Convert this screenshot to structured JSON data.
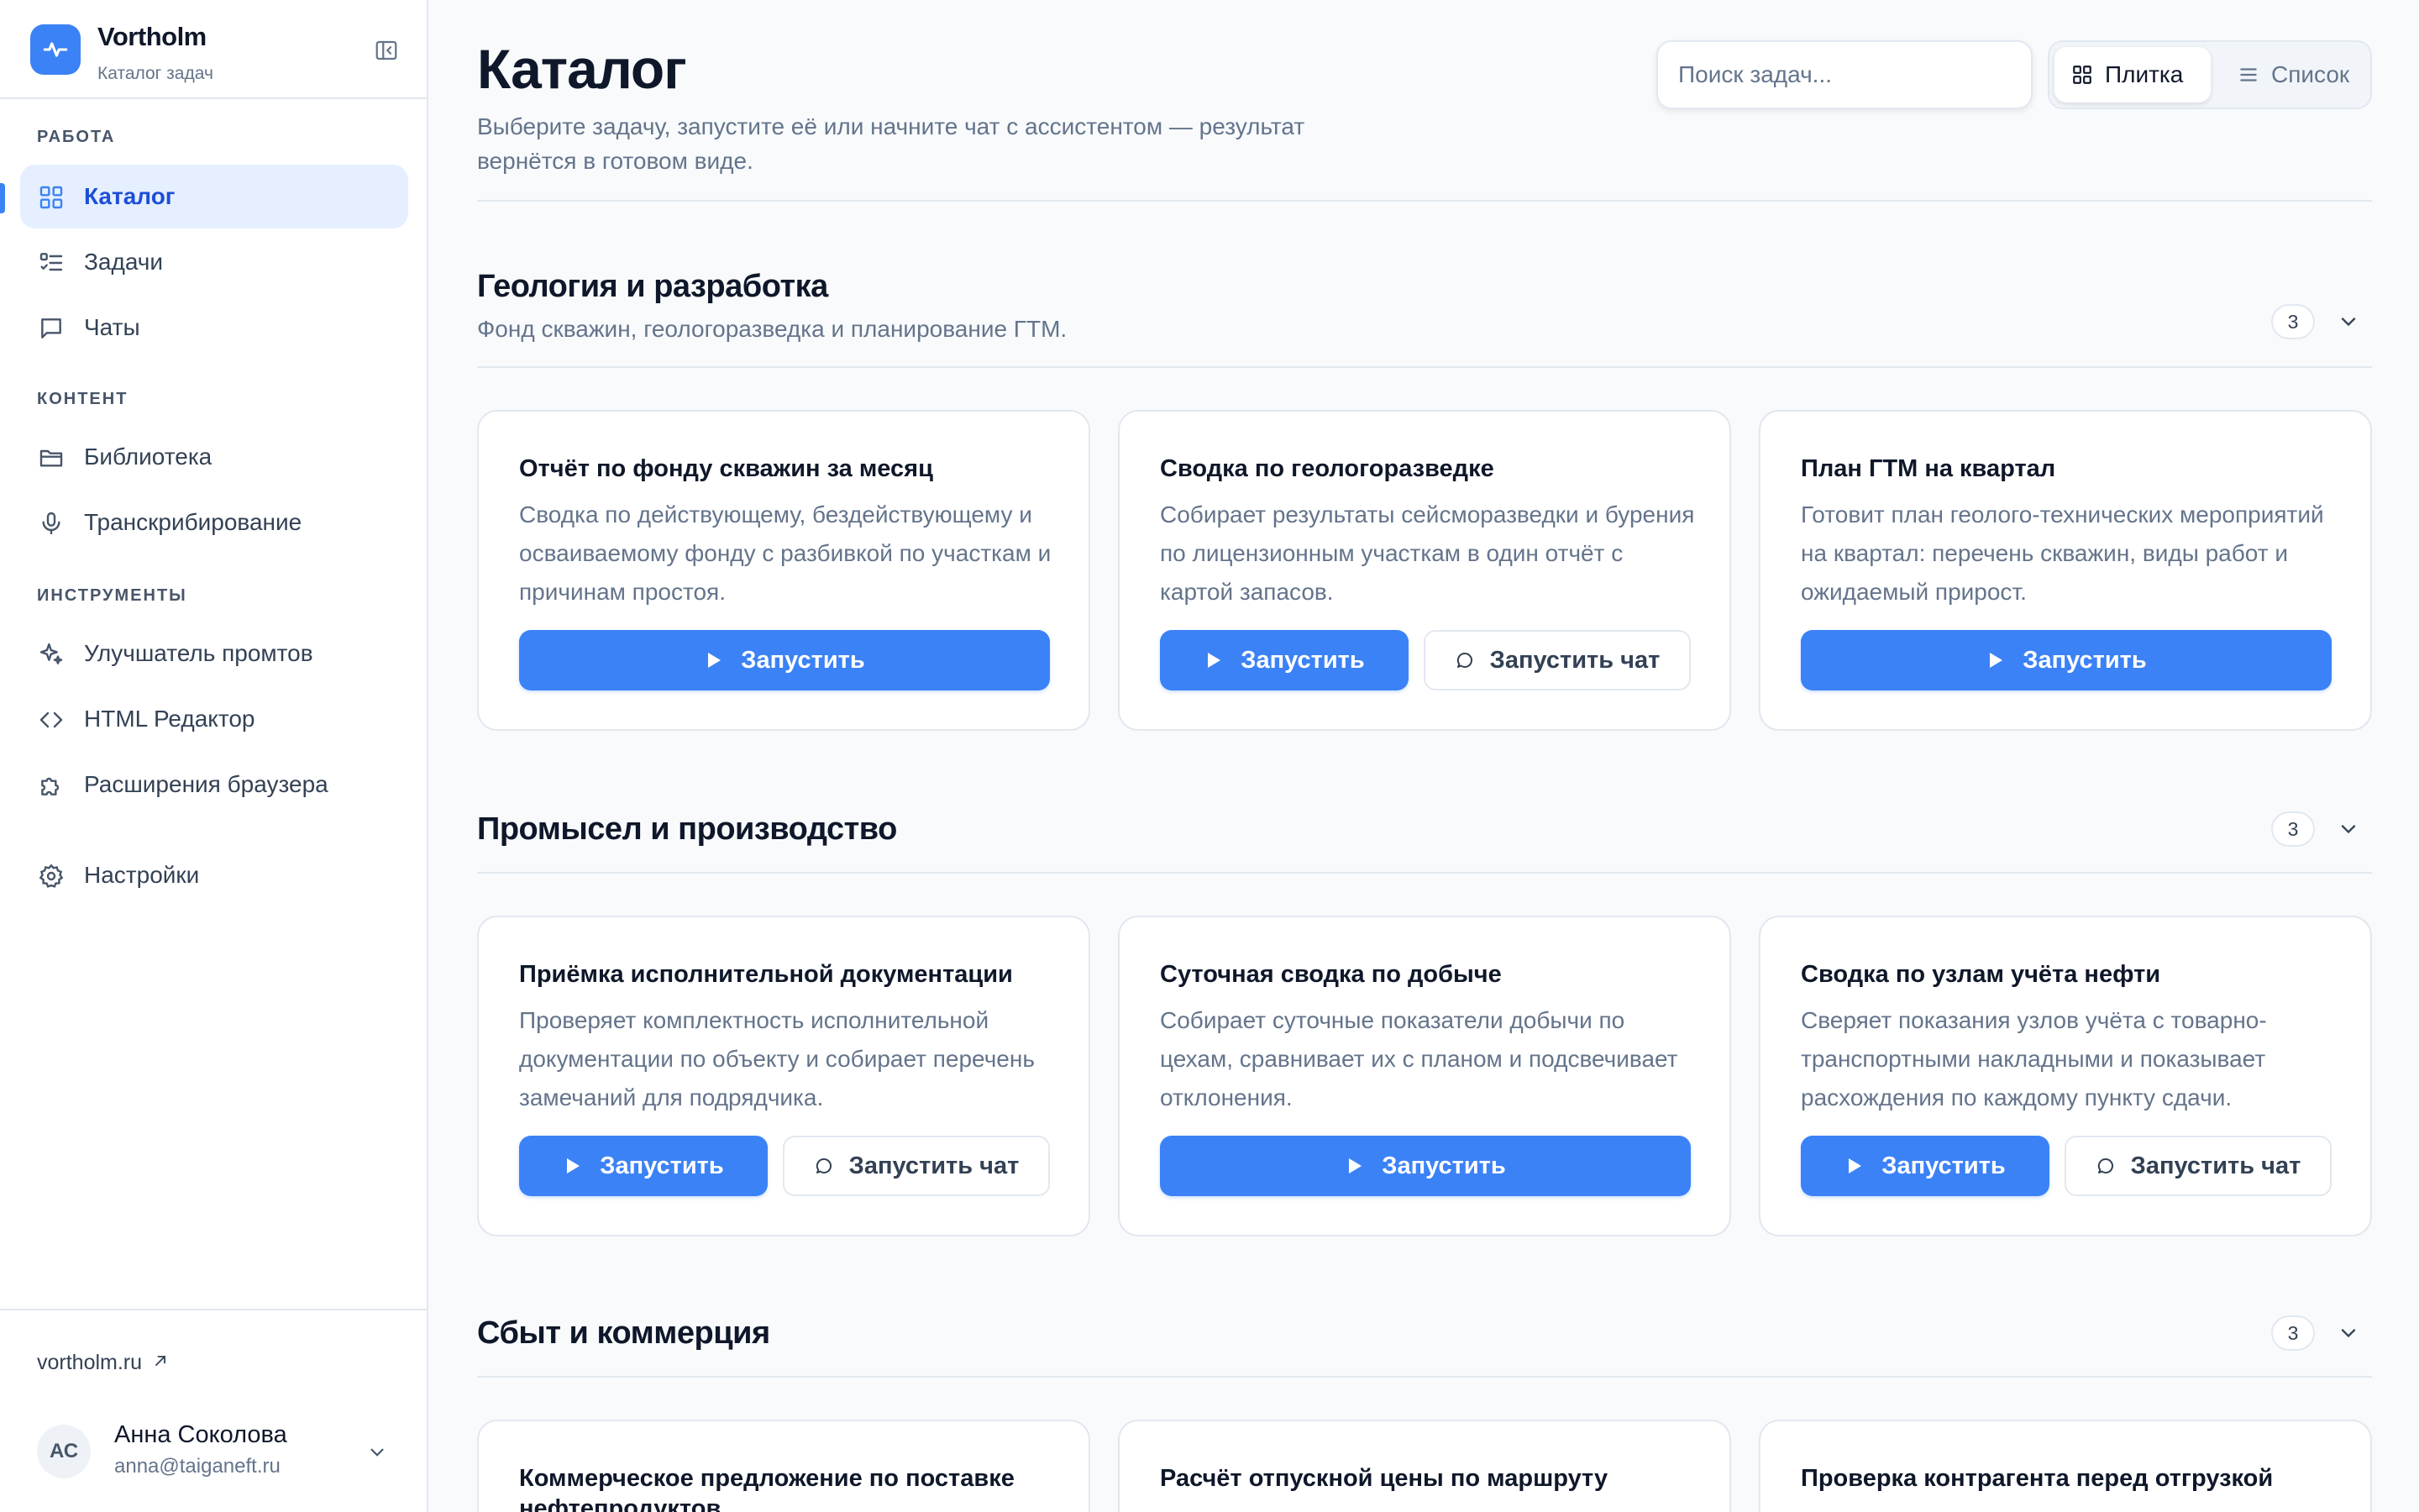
{
  "brand": {
    "name": "Vortholm",
    "subtitle": "Каталог задач"
  },
  "sidebar": {
    "sections": [
      {
        "title": "РАБОТА",
        "items": [
          {
            "label": "Каталог",
            "icon": "grid-icon",
            "active": true
          },
          {
            "label": "Задачи",
            "icon": "task-list-icon"
          },
          {
            "label": "Чаты",
            "icon": "chat-icon"
          }
        ]
      },
      {
        "title": "КОНТЕНТ",
        "items": [
          {
            "label": "Библиотека",
            "icon": "folder-icon"
          },
          {
            "label": "Транскрибирование",
            "icon": "microphone-icon"
          }
        ]
      },
      {
        "title": "ИНСТРУМЕНТЫ",
        "items": [
          {
            "label": "Улучшатель промтов",
            "icon": "sparkles-icon"
          },
          {
            "label": "HTML Редактор",
            "icon": "code-icon"
          },
          {
            "label": "Расширения браузера",
            "icon": "puzzle-icon"
          }
        ]
      }
    ],
    "settings": {
      "label": "Настройки",
      "icon": "gear-icon"
    },
    "footer": {
      "site_link": "vortholm.ru",
      "user": {
        "initials": "АС",
        "name": "Анна Соколова",
        "email": "anna@taiganeft.ru"
      }
    }
  },
  "header": {
    "title": "Каталог",
    "subtitle": "Выберите задачу, запустите её или начните чат с ассистентом — результат вернётся в готовом виде.",
    "search_placeholder": "Поиск задач...",
    "view_tile": "Плитка",
    "view_list": "Список"
  },
  "colors": {
    "accent": "#3b82f6",
    "active_bg": "#e5efff",
    "border": "#e2e8f0",
    "muted_text": "#64748b"
  },
  "buttons": {
    "run": "Запустить",
    "chat": "Запустить чат"
  },
  "sections": [
    {
      "title": "Геология и разработка",
      "description": "Фонд скважин, геологоразведка и планирование ГТМ.",
      "count": "3",
      "cards": [
        {
          "title": "Отчёт по фонду скважин за месяц",
          "description": "Сводка по действующему, бездействующему и осваиваемому фонду с разбивкой по участкам и причинам простоя.",
          "has_chat": false
        },
        {
          "title": "Сводка по геологоразведке",
          "description": "Собирает результаты сейсморазведки и бурения по лицензионным участкам в один отчёт с картой запасов.",
          "has_chat": true
        },
        {
          "title": "План ГТМ на квартал",
          "description": "Готовит план геолого-технических мероприятий на квартал: перечень скважин, виды работ и ожидаемый прирост.",
          "has_chat": false
        }
      ]
    },
    {
      "title": "Промысел и производство",
      "description": "",
      "count": "3",
      "cards": [
        {
          "title": "Приёмка исполнительной документации",
          "description": "Проверяет комплектность исполнительной документации по объекту и собирает перечень замечаний для подрядчика.",
          "has_chat": true
        },
        {
          "title": "Суточная сводка по добыче",
          "description": "Собирает суточные показатели добычи по цехам, сравнивает их с планом и подсвечивает отклонения.",
          "has_chat": false
        },
        {
          "title": "Сводка по узлам учёта нефти",
          "description": "Сверяет показания узлов учёта с товарно-транспортными накладными и показывает расхождения по каждому пункту сдачи.",
          "has_chat": true
        }
      ]
    },
    {
      "title": "Сбыт и коммерция",
      "description": "",
      "count": "3",
      "cards": [
        {
          "title": "Коммерческое предложение по поставке нефтепродуктов",
          "description": "",
          "has_chat": false
        },
        {
          "title": "Расчёт отпускной цены по маршруту",
          "description": "",
          "has_chat": false
        },
        {
          "title": "Проверка контрагента перед отгрузкой",
          "description": "",
          "has_chat": false
        }
      ]
    }
  ]
}
